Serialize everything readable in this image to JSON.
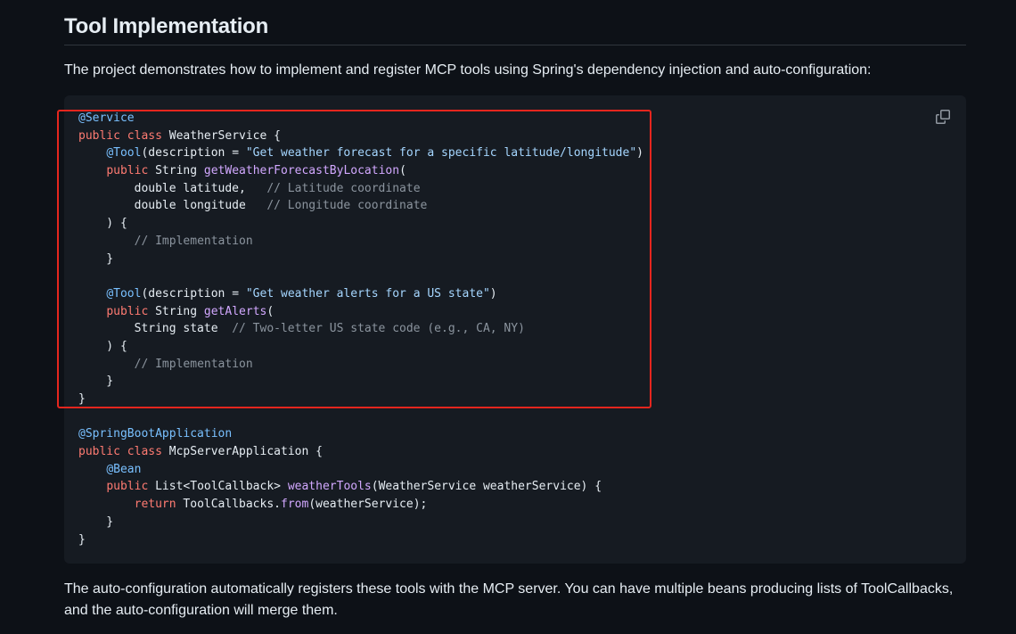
{
  "section": {
    "heading": "Tool Implementation",
    "intro": "The project demonstrates how to implement and register MCP tools using Spring's dependency injection and auto-configuration:",
    "outro": "The auto-configuration automatically registers these tools with the MCP server. You can have multiple beans producing lists of ToolCallbacks, and the auto-configuration will merge them."
  },
  "code_block": {
    "language": "java",
    "copy_icon": "copy-icon",
    "lines": [
      [
        [
          "ann",
          "@Service"
        ]
      ],
      [
        [
          "kw",
          "public"
        ],
        [
          "txt",
          " "
        ],
        [
          "kw",
          "class"
        ],
        [
          "txt",
          " WeatherService {"
        ]
      ],
      [
        [
          "txt",
          "    "
        ],
        [
          "ann",
          "@Tool"
        ],
        [
          "txt",
          "(description = "
        ],
        [
          "str",
          "\"Get weather forecast for a specific latitude/longitude\""
        ],
        [
          "txt",
          ")"
        ]
      ],
      [
        [
          "txt",
          "    "
        ],
        [
          "kw",
          "public"
        ],
        [
          "txt",
          " String "
        ],
        [
          "fn",
          "getWeatherForecastByLocation"
        ],
        [
          "txt",
          "("
        ]
      ],
      [
        [
          "txt",
          "        double latitude,   "
        ],
        [
          "com",
          "// Latitude coordinate"
        ]
      ],
      [
        [
          "txt",
          "        double longitude   "
        ],
        [
          "com",
          "// Longitude coordinate"
        ]
      ],
      [
        [
          "txt",
          "    ) {"
        ]
      ],
      [
        [
          "txt",
          "        "
        ],
        [
          "com",
          "// Implementation"
        ]
      ],
      [
        [
          "txt",
          "    }"
        ]
      ],
      [],
      [
        [
          "txt",
          "    "
        ],
        [
          "ann",
          "@Tool"
        ],
        [
          "txt",
          "(description = "
        ],
        [
          "str",
          "\"Get weather alerts for a US state\""
        ],
        [
          "txt",
          ")"
        ]
      ],
      [
        [
          "txt",
          "    "
        ],
        [
          "kw",
          "public"
        ],
        [
          "txt",
          " String "
        ],
        [
          "fn",
          "getAlerts"
        ],
        [
          "txt",
          "("
        ]
      ],
      [
        [
          "txt",
          "        String state  "
        ],
        [
          "com",
          "// Two-letter US state code (e.g., CA, NY)"
        ]
      ],
      [
        [
          "txt",
          "    ) {"
        ]
      ],
      [
        [
          "txt",
          "        "
        ],
        [
          "com",
          "// Implementation"
        ]
      ],
      [
        [
          "txt",
          "    }"
        ]
      ],
      [
        [
          "txt",
          "}"
        ]
      ],
      [],
      [
        [
          "ann",
          "@SpringBootApplication"
        ]
      ],
      [
        [
          "kw",
          "public"
        ],
        [
          "txt",
          " "
        ],
        [
          "kw",
          "class"
        ],
        [
          "txt",
          " McpServerApplication {"
        ]
      ],
      [
        [
          "txt",
          "    "
        ],
        [
          "ann",
          "@Bean"
        ]
      ],
      [
        [
          "txt",
          "    "
        ],
        [
          "kw",
          "public"
        ],
        [
          "txt",
          " List<ToolCallback> "
        ],
        [
          "fn",
          "weatherTools"
        ],
        [
          "txt",
          "(WeatherService weatherService) {"
        ]
      ],
      [
        [
          "txt",
          "        "
        ],
        [
          "kw",
          "return"
        ],
        [
          "txt",
          " ToolCallbacks."
        ],
        [
          "fn",
          "from"
        ],
        [
          "txt",
          "(weatherService);"
        ]
      ],
      [
        [
          "txt",
          "    }"
        ]
      ],
      [
        [
          "txt",
          "}"
        ]
      ]
    ]
  },
  "highlight": {
    "color": "#e5261e",
    "covers_lines": [
      1,
      17
    ]
  },
  "colors": {
    "background": "#0d1117",
    "code_background": "#161b22",
    "keyword": "#ff7b72",
    "annotation": "#79c0ff",
    "function": "#d2a8ff",
    "string": "#a5d6ff",
    "comment": "#8b949e"
  }
}
